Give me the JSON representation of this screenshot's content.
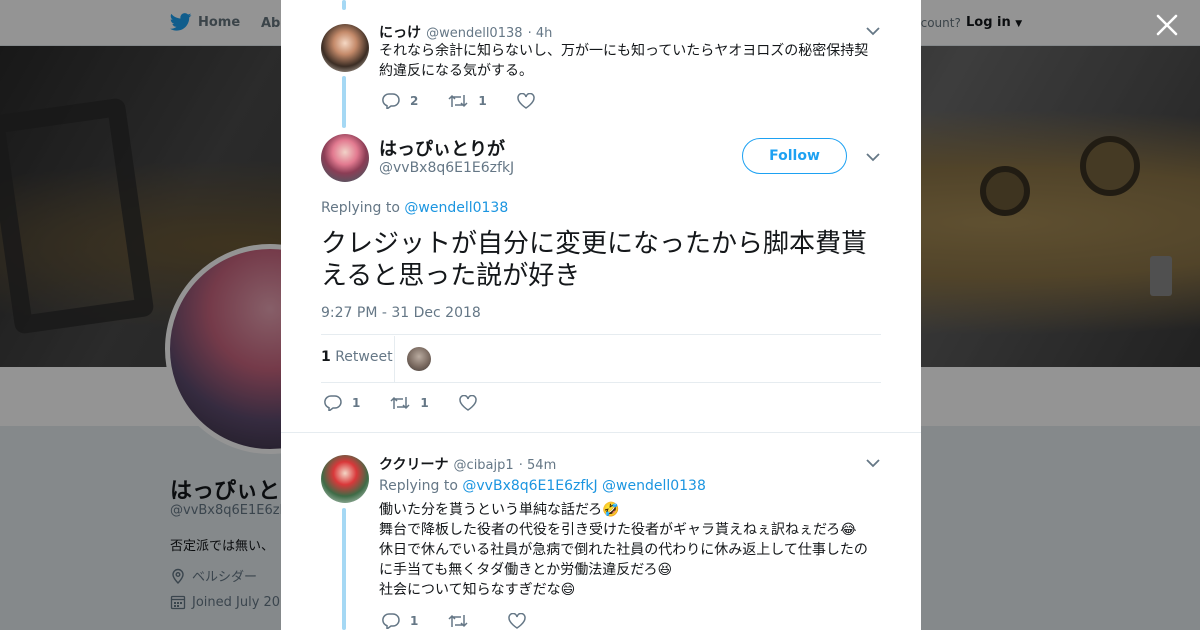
{
  "nav": {
    "home_label": "Home",
    "about_label": "Abo",
    "account_text": "ccount?",
    "login_label": "Log in"
  },
  "profile": {
    "name": "はっぴぃと",
    "handle": "@vvBx8q6E1E6zk",
    "bio": "否定派では無い、",
    "location": "ベルシダー",
    "joined": "Joined July 20"
  },
  "reply_top": {
    "name": "にっけ",
    "handle": "@wendell0138",
    "time": "· 4h",
    "text": "それなら余計に知らないし、万が一にも知っていたらヤオヨロズの秘密保持契約違反になる気がする。",
    "replies": "2",
    "retweets": "1",
    "likes": ""
  },
  "main_tweet": {
    "name": "はっぴぃとりが",
    "handle": "@vvBx8q6E1E6zfkJ",
    "follow_label": "Follow",
    "replying_prefix": "Replying to",
    "replying_to": "@wendell0138",
    "text": "クレジットが自分に変更になったから脚本費貰えると思った説が好き",
    "timestamp": "9:27 PM - 31 Dec 2018",
    "retweet_count": "1",
    "retweet_label": "Retweet",
    "replies": "1",
    "retweets": "1",
    "likes": ""
  },
  "reply_bottom": {
    "name": "ククリーナ",
    "handle": "@cibajp1",
    "time": "· 54m",
    "replying_prefix": "Replying to",
    "replying_to_1": "@vvBx8q6E1E6zfkJ",
    "replying_to_2": "@wendell0138",
    "lines": [
      "働いた分を貰うという単純な話だろ🤣",
      "舞台で降板した役者の代役を引き受けた役者がギャラ貰えねぇ訳ねぇだろ😂",
      "休日で休んでいる社員が急病で倒れた社員の代わりに休み返上して仕事したのに手当ても無くタダ働きとか労働法違反だろ😆",
      "社会について知らなすぎだな😄"
    ],
    "replies": "1",
    "retweets": "",
    "likes": ""
  },
  "colors": {
    "accent": "#1da1f2",
    "link": "#1b95e0",
    "thread": "#a5d8f4",
    "muted": "#657786"
  },
  "icons": [
    "twitter-bird-icon",
    "close-icon",
    "chevron-down-icon",
    "reply-icon",
    "retweet-icon",
    "like-icon",
    "location-icon",
    "calendar-icon"
  ]
}
